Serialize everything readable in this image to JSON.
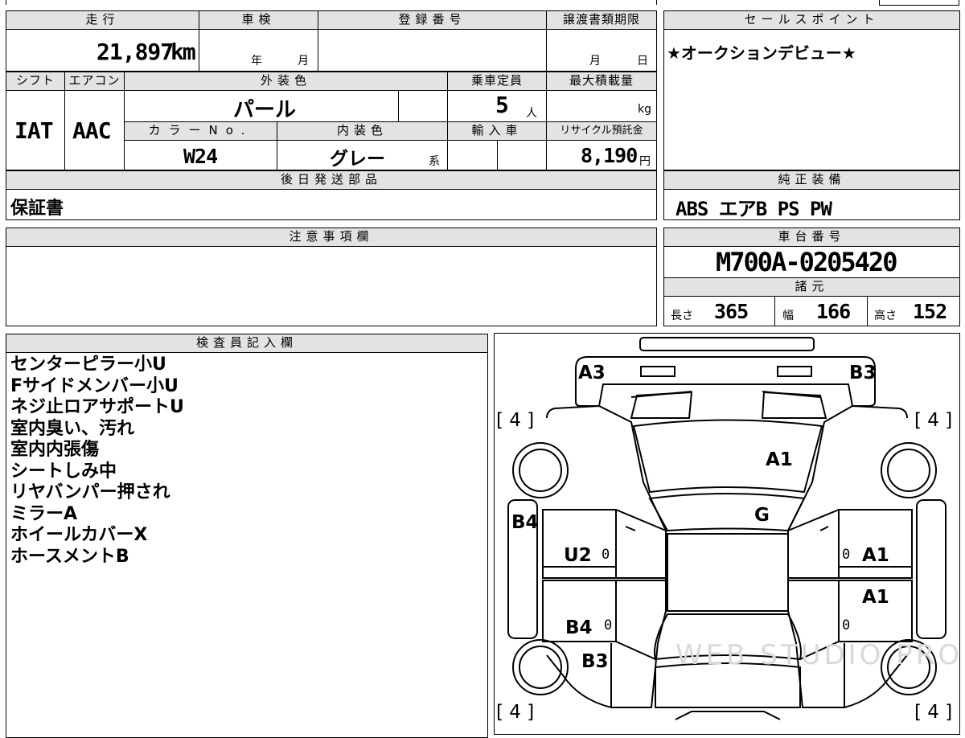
{
  "top": {
    "headers": {
      "mileage": "走行",
      "inspection": "車検",
      "registration": "登録番号",
      "transfer_deadline": "譲渡書類期限",
      "shift": "シフト",
      "aircon": "エアコン",
      "exterior_color": "外装色",
      "capacity": "乗車定員",
      "max_load": "最大積載量",
      "color_no": "カラーNo.",
      "interior_color": "内装色",
      "imported": "輸入車",
      "recycle_fee": "リサイクル預託金"
    },
    "mileage_value": "21,897",
    "mileage_unit": "km",
    "inspection_year_label": "年",
    "inspection_month_label": "月",
    "deadline_month_label": "月",
    "deadline_day_label": "日",
    "shift_value": "IAT",
    "aircon_value": "AAC",
    "exterior_color_value": "パール",
    "capacity_value": "5",
    "capacity_unit": "人",
    "max_load_unit": "kg",
    "color_no_value": "W24",
    "interior_color_value": "グレー",
    "interior_color_suffix": "系",
    "recycle_value": "8,190",
    "recycle_unit": "円"
  },
  "later_parts": {
    "header": "後日発送部品",
    "value": "保証書"
  },
  "sales_point": {
    "header": "セールスポイント",
    "value": "★オークションデビュー★"
  },
  "equipment": {
    "header": "純正装備",
    "value": "ABS エアB PS PW"
  },
  "notes": {
    "header": "注意事項欄"
  },
  "chassis": {
    "header": "車台番号",
    "value": "M700A-0205420"
  },
  "specs": {
    "header": "諸元",
    "length_label": "長さ",
    "length_value": "365",
    "width_label": "幅",
    "width_value": "166",
    "height_label": "高さ",
    "height_value": "152"
  },
  "inspector": {
    "header": "検査員記入欄",
    "lines": [
      "センターピラー小U",
      "Fサイドメンバー小U",
      "ネジ止ロアサポートU",
      "室内臭い、汚れ",
      "室内内張傷",
      "シートしみ中",
      "リヤバンパー押され",
      "ミラーA",
      "ホイールカバーX",
      "ホースメントB"
    ]
  },
  "diagram": {
    "tire_front_left": "[ 4 ]",
    "tire_front_right": "[ 4 ]",
    "tire_rear_left": "[ 4 ]",
    "tire_rear_right": "[ 4 ]",
    "label_a3": "A3",
    "label_b3_top": "B3",
    "label_a1_hood": "A1",
    "label_g": "G",
    "label_b4_side": "B4",
    "label_u2": "U2",
    "label_a1_door_front": "A1",
    "label_a1_door_rear": "A1",
    "label_b4_door": "B4",
    "label_b3_rear": "B3",
    "zero_1": "0",
    "zero_2": "0",
    "zero_3": "0",
    "zero_4": "0",
    "watermark": "WEB STUDIO PRO"
  }
}
